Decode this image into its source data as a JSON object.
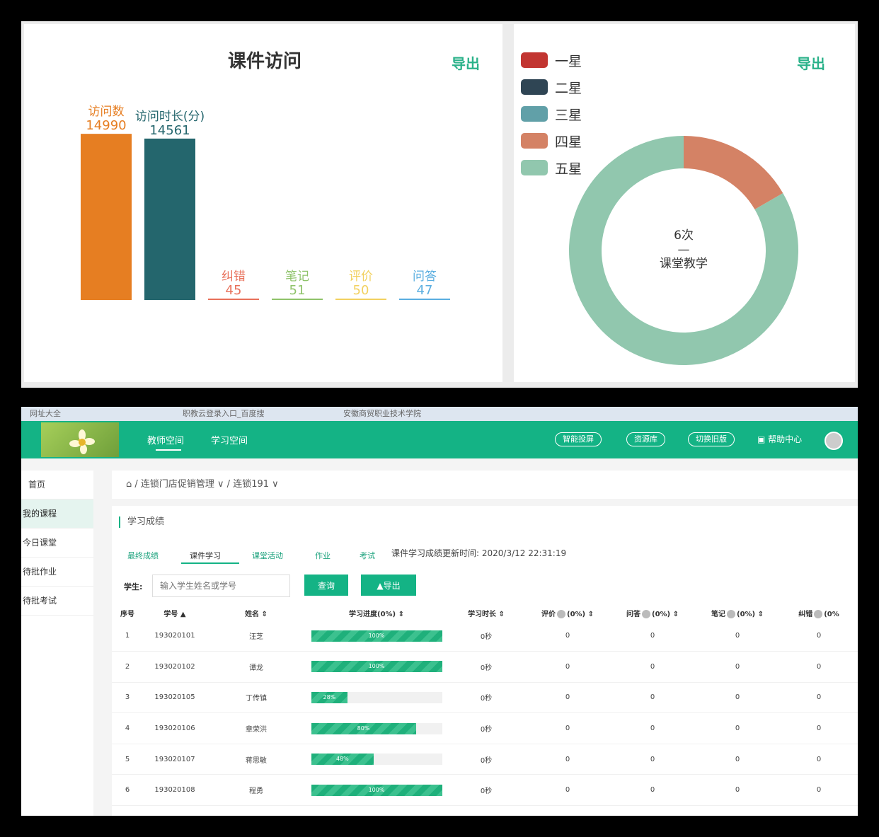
{
  "chart_data": [
    {
      "type": "bar",
      "title": "课件访问",
      "categories": [
        "访问数",
        "访问时长(分)",
        "纠错",
        "笔记",
        "评价",
        "问答"
      ],
      "values": [
        14990,
        14561,
        45,
        51,
        50,
        47
      ],
      "colors": [
        "#e67e22",
        "#24666d",
        "#e8705a",
        "#8fc36a",
        "#f2d15f",
        "#5aaee0"
      ],
      "ylim": [
        0,
        15000
      ]
    },
    {
      "type": "pie",
      "categories": [
        "一星",
        "二星",
        "三星",
        "四星",
        "五星"
      ],
      "values": [
        0,
        0,
        0,
        1,
        5
      ],
      "colors": [
        "#c23531",
        "#2f4554",
        "#61a0a8",
        "#d48265",
        "#91c7ae"
      ],
      "center_label": [
        "6次",
        "—",
        "课堂教学"
      ],
      "legend": "top-left"
    }
  ],
  "panels": {
    "export_label": "导出"
  },
  "browser": {
    "tabs": [
      "网址大全",
      "职教云登录入口_百度搜",
      "安徽商贸职业技术学院"
    ]
  },
  "header": {
    "nav": [
      "教师空间",
      "学习空间"
    ],
    "buttons": [
      "智能投屏",
      "资源库",
      "切换旧版"
    ],
    "help": "帮助中心"
  },
  "sidebar": {
    "items": [
      "首页",
      "我的课程",
      "今日课堂",
      "待批作业",
      "待批考试"
    ]
  },
  "breadcrumb": "⌂ / 连锁门店促销管理 ∨ / 连锁191 ∨",
  "section": {
    "title": "学习成绩",
    "tabs": [
      "最终成绩",
      "课件学习",
      "课堂活动",
      "作业",
      "考试"
    ],
    "update_time": "课件学习成绩更新时间:  2020/3/12 22:31:19",
    "student_label": "学生:",
    "search_placeholder": "输入学生姓名或学号",
    "query_button": "查询",
    "export_button": "导出"
  },
  "table": {
    "headers": [
      "序号",
      "学号 ▲",
      "姓名 ⇕",
      "学习进度(0%) ⇕",
      "学习时长 ⇕",
      "评价",
      "(0%) ⇕",
      "问答",
      "(0%) ⇕",
      "笔记",
      "(0%) ⇕",
      "纠错",
      "(0%"
    ],
    "rows": [
      {
        "no": "1",
        "id": "193020101",
        "name": "汪芝",
        "progress": 100,
        "progress_label": "100%",
        "duration": "0秒",
        "eval": "0",
        "qa": "0",
        "notes": "0",
        "errata": "0"
      },
      {
        "no": "2",
        "id": "193020102",
        "name": "谭龙",
        "progress": 100,
        "progress_label": "100%",
        "duration": "0秒",
        "eval": "0",
        "qa": "0",
        "notes": "0",
        "errata": "0"
      },
      {
        "no": "3",
        "id": "193020105",
        "name": "丁传镇",
        "progress": 28,
        "progress_label": "28%",
        "duration": "0秒",
        "eval": "0",
        "qa": "0",
        "notes": "0",
        "errata": "0"
      },
      {
        "no": "4",
        "id": "193020106",
        "name": "章荣洪",
        "progress": 80,
        "progress_label": "80%",
        "duration": "0秒",
        "eval": "0",
        "qa": "0",
        "notes": "0",
        "errata": "0"
      },
      {
        "no": "5",
        "id": "193020107",
        "name": "蒋思敏",
        "progress": 48,
        "progress_label": "48%",
        "duration": "0秒",
        "eval": "0",
        "qa": "0",
        "notes": "0",
        "errata": "0"
      },
      {
        "no": "6",
        "id": "193020108",
        "name": "程勇",
        "progress": 100,
        "progress_label": "100%",
        "duration": "0秒",
        "eval": "0",
        "qa": "0",
        "notes": "0",
        "errata": "0"
      }
    ]
  }
}
